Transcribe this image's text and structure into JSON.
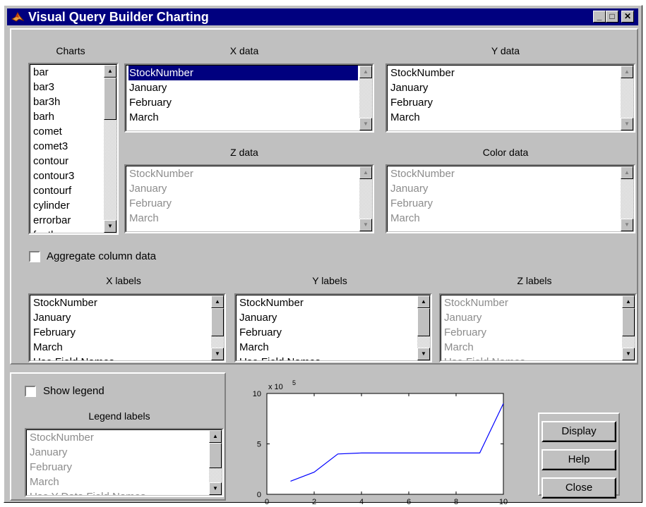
{
  "window": {
    "title": "Visual Query Builder Charting",
    "minimize": "_",
    "maximize": "□",
    "close": "✕"
  },
  "charts": {
    "label": "Charts",
    "items": [
      "bar",
      "bar3",
      "bar3h",
      "barh",
      "comet",
      "comet3",
      "contour",
      "contour3",
      "contourf",
      "cylinder",
      "errorbar",
      "feather"
    ]
  },
  "xdata": {
    "label": "X data",
    "items": [
      "StockNumber",
      "January",
      "February",
      "March"
    ],
    "selected": 0
  },
  "ydata": {
    "label": "Y data",
    "items": [
      "StockNumber",
      "January",
      "February",
      "March"
    ]
  },
  "zdata": {
    "label": "Z data",
    "items": [
      "StockNumber",
      "January",
      "February",
      "March"
    ]
  },
  "colordata": {
    "label": "Color data",
    "items": [
      "StockNumber",
      "January",
      "February",
      "March"
    ]
  },
  "aggregate": {
    "label": "Aggregate column data",
    "checked": false
  },
  "xlabels": {
    "label": "X labels",
    "items": [
      "StockNumber",
      "January",
      "February",
      "March",
      "Use Field Names"
    ]
  },
  "ylabels": {
    "label": "Y labels",
    "items": [
      "StockNumber",
      "January",
      "February",
      "March",
      "Use Field Names"
    ]
  },
  "zlabels": {
    "label": "Z labels",
    "items": [
      "StockNumber",
      "January",
      "February",
      "March",
      "Use Field Names"
    ]
  },
  "legend": {
    "show_label": "Show legend",
    "checked": false,
    "labels_label": "Legend labels",
    "items": [
      "StockNumber",
      "January",
      "February",
      "March",
      "Use Y Data Field Names"
    ]
  },
  "buttons": {
    "display": "Display",
    "help": "Help",
    "close": "Close"
  },
  "chart_data": {
    "type": "line",
    "x": [
      1,
      2,
      3,
      4,
      5,
      6,
      7,
      8,
      9,
      10
    ],
    "y": [
      130000,
      220000,
      400000,
      410000,
      410000,
      410000,
      410000,
      410000,
      410000,
      900000
    ],
    "xlim": [
      0,
      10
    ],
    "ylim": [
      0,
      1000000
    ],
    "xticks": [
      "0",
      "2",
      "4",
      "6",
      "8",
      "10"
    ],
    "yticks": [
      "0",
      "5",
      "10"
    ],
    "exponent_label": "x 10",
    "exponent_power": "5",
    "color": "#0000ff",
    "grid": false
  }
}
